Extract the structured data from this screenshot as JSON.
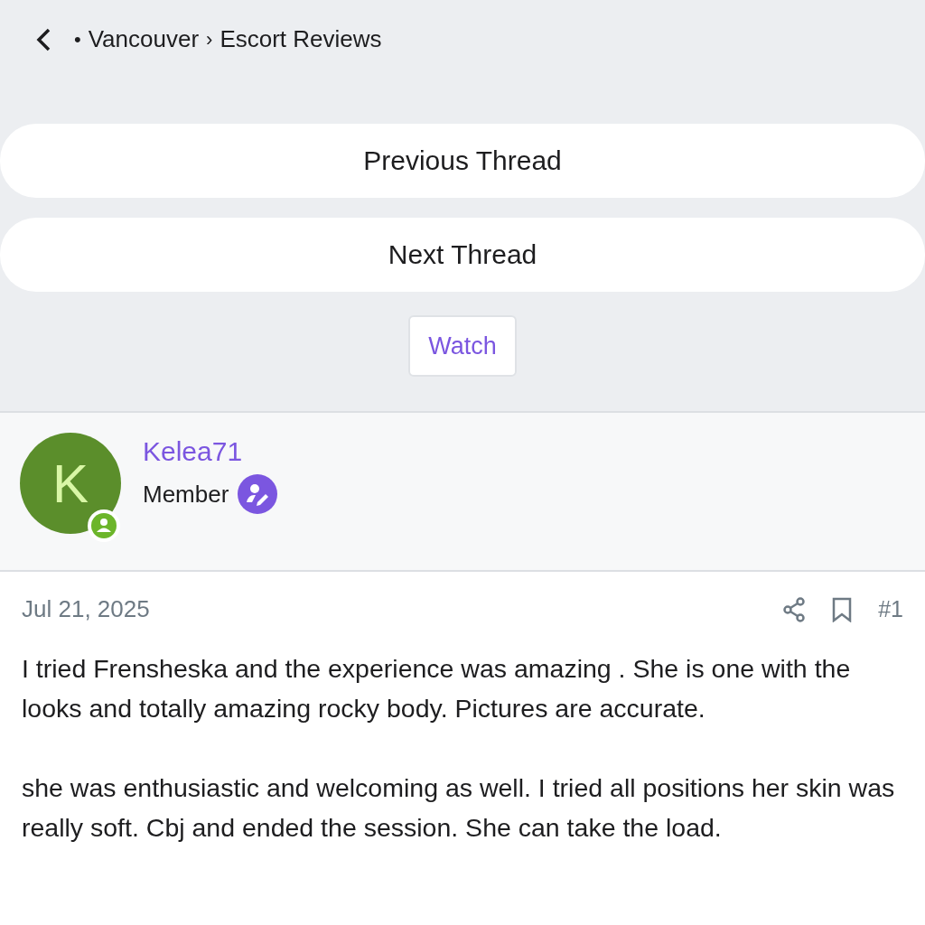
{
  "breadcrumb": [
    {
      "kind": "bullet",
      "text": "•"
    },
    {
      "kind": "link",
      "text": "Vancouver"
    },
    {
      "kind": "separator",
      "text": "›"
    },
    {
      "kind": "link",
      "text": "Escort Reviews"
    }
  ],
  "thread_nav": [
    "Previous Thread",
    "Next Thread"
  ],
  "watch_button": "Watch",
  "author": {
    "initial": "K",
    "name": "Kelea71",
    "role": "Member",
    "online": true
  },
  "post": {
    "date": "Jul 21, 2025",
    "number": "#1",
    "paragraphs": [
      "I tried Frensheska and the experience was amazing . She is one with the looks and totally amazing rocky body. Pictures are accurate.",
      "she was enthusiastic and welcoming as well. I tried all positions her skin was really soft. Cbj and ended the session. She can take the load."
    ]
  }
}
